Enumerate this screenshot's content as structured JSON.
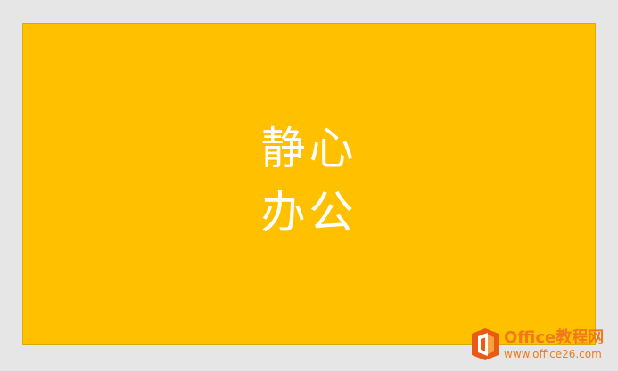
{
  "slide": {
    "line1": "静心",
    "line2": "办公",
    "background_color": "#ffc000",
    "text_color": "#ffffff"
  },
  "watermark": {
    "title": "Office教程网",
    "url": "www.office26.com",
    "logo_icon": "office-logo-icon",
    "color": "#f07a1a"
  }
}
